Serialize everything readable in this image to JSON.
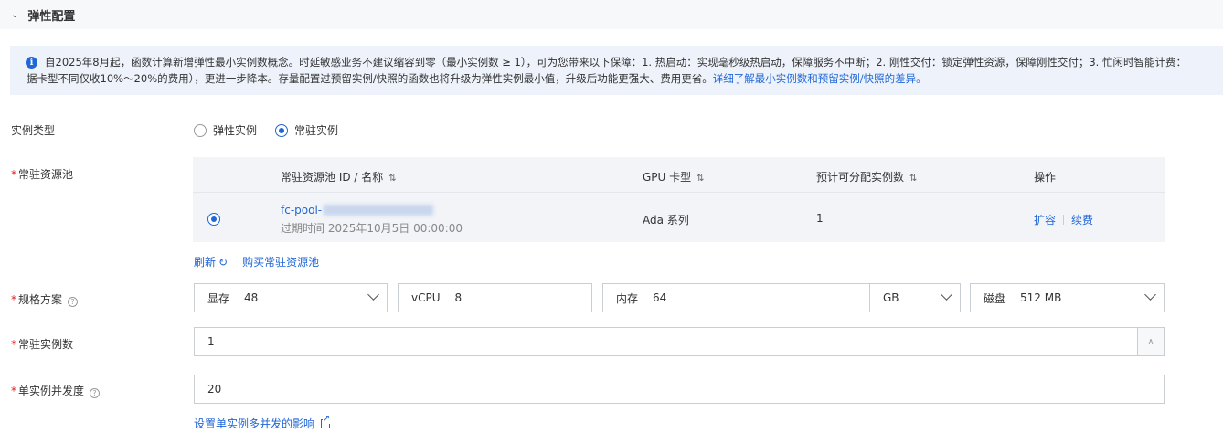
{
  "section": {
    "title": "弹性配置"
  },
  "notice": {
    "line1": "自2025年8月起，函数计算新增弹性最小实例数概念。时延敏感业务不建议缩容到零（最小实例数 ≥ 1），可为您带来以下保障：1. 热启动：实现毫秒级热启动，保障服务不中断；2. 刚性交付：锁定弹性资源，保障刚性交付；3. 忙闲时智能计费：",
    "line2": "据卡型不同仅收10%～20%的费用），更进一步降本。存量配置过预留实例/快照的函数也将升级为弹性实例最小值，升级后功能更强大、费用更省。",
    "link": "详细了解最小实例数和预留实例/快照的差异。"
  },
  "instance_type": {
    "label": "实例类型",
    "options": [
      {
        "label": "弹性实例",
        "selected": false
      },
      {
        "label": "常驻实例",
        "selected": true
      }
    ]
  },
  "pool": {
    "label": "常驻资源池",
    "columns": [
      "常驻资源池 ID / 名称",
      "GPU 卡型",
      "预计可分配实例数",
      "操作"
    ],
    "sort_icon": "⇅",
    "row": {
      "id_prefix": "fc-pool-",
      "expire": "过期时间 2025年10月5日 00:00:00",
      "gpu": "Ada 系列",
      "count": "1",
      "action_expand": "扩容",
      "action_renew": "续费"
    },
    "refresh": "刷新",
    "buy": "购买常驻资源池"
  },
  "spec": {
    "label": "规格方案",
    "vram_key": "显存",
    "vram_val": "48",
    "vcpu_key": "vCPU",
    "vcpu_val": "8",
    "mem_key": "内存",
    "mem_val": "64",
    "mem_unit": "GB",
    "disk_key": "磁盘",
    "disk_val": "512 MB"
  },
  "resident_count": {
    "label": "常驻实例数",
    "value": "1"
  },
  "concurrency": {
    "label": "单实例并发度",
    "value": "20",
    "link": "设置单实例多并发的影响"
  },
  "colors": {
    "accent": "#1f66d6",
    "required": "#e02020",
    "notice_bg": "#eef3fb"
  }
}
